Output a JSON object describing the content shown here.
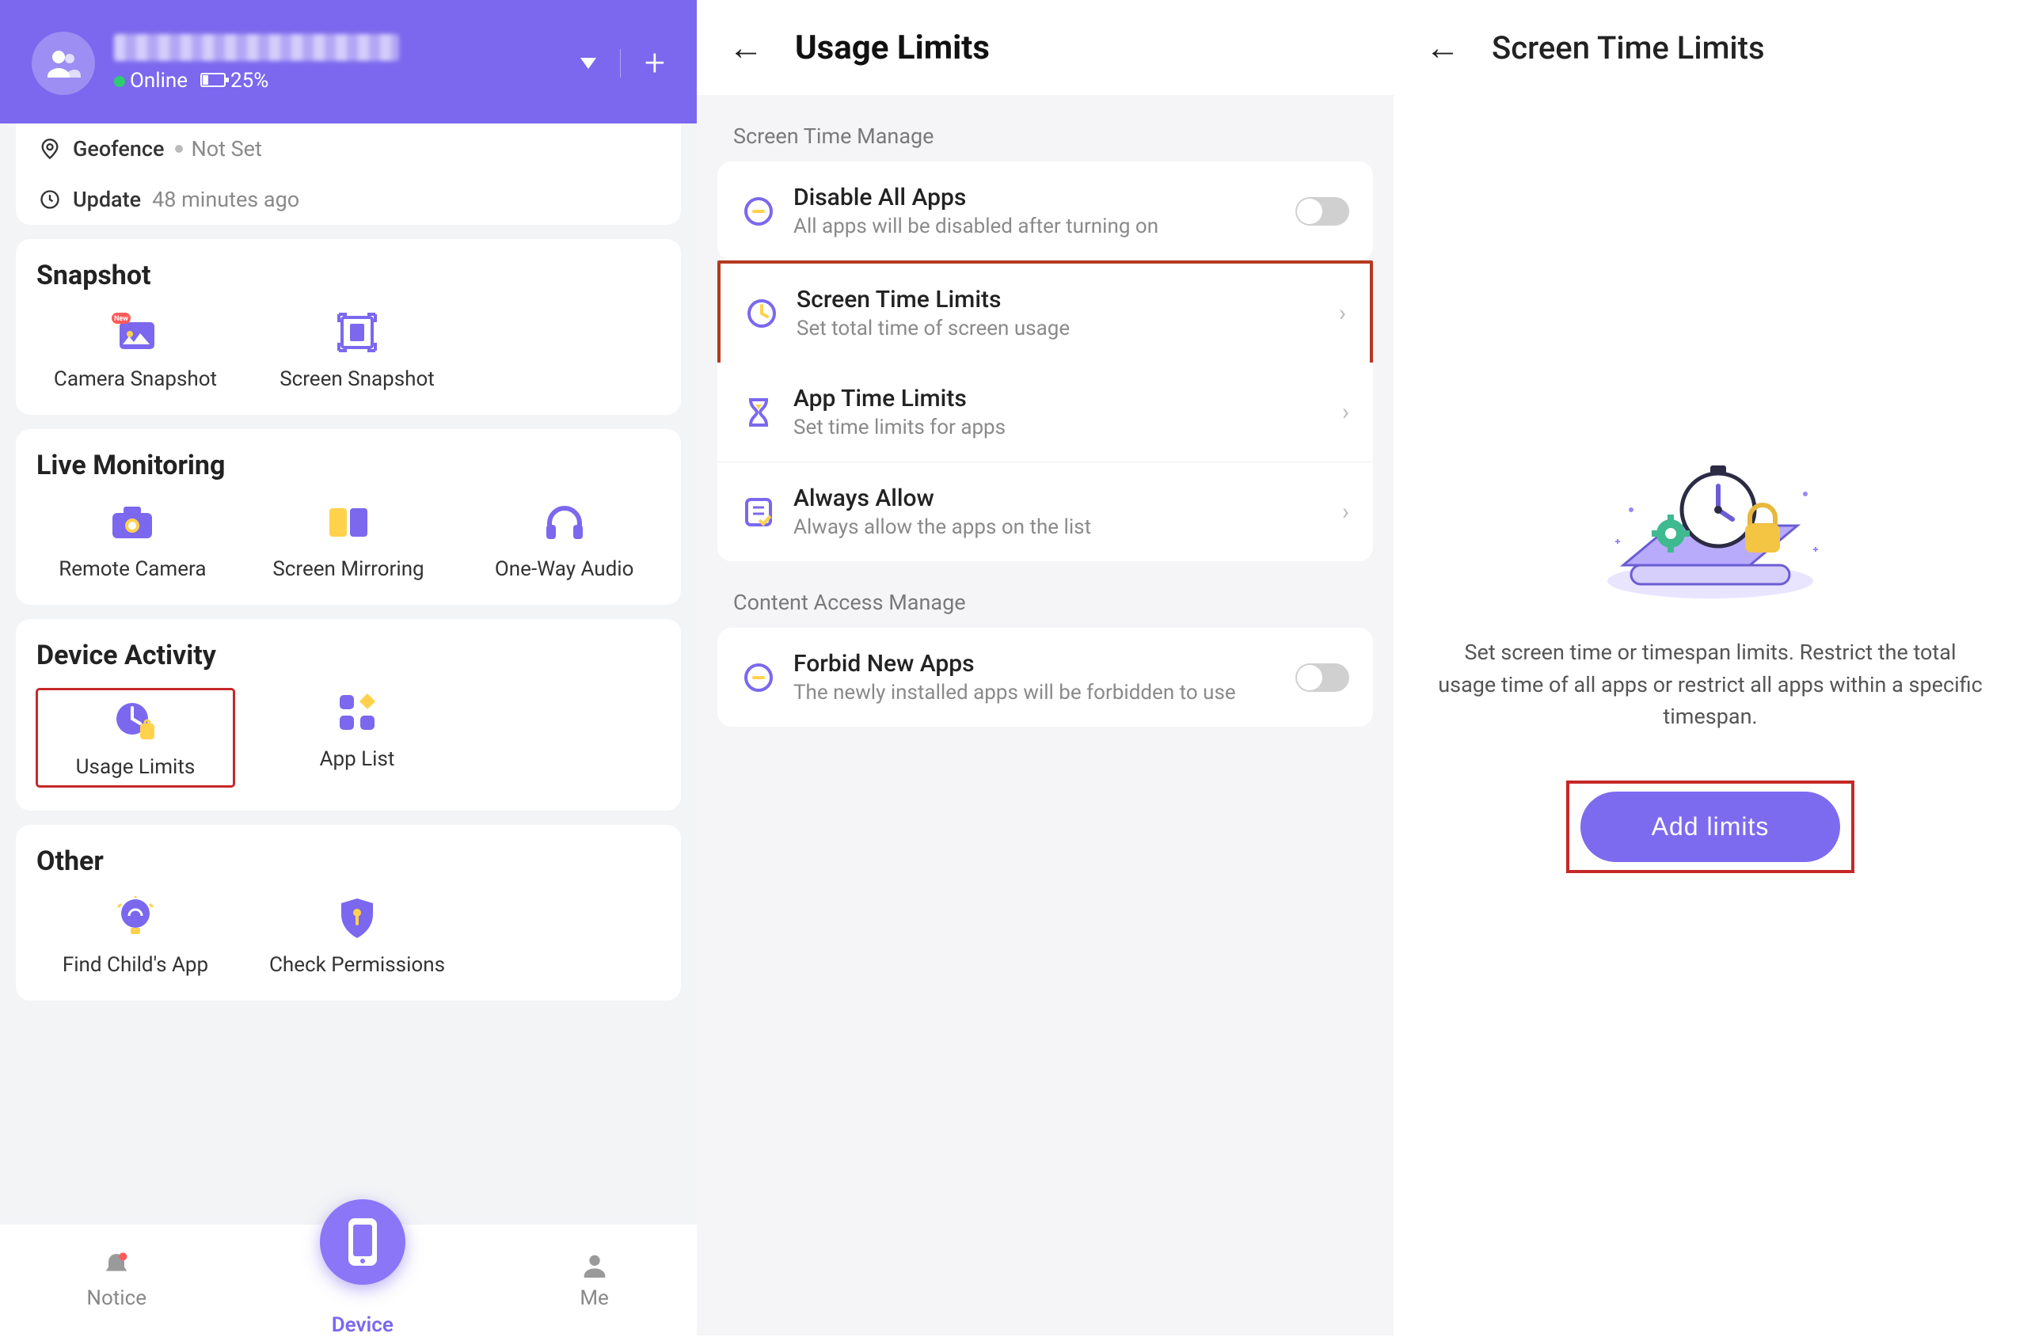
{
  "panel1": {
    "header": {
      "online_label": "Online",
      "battery_label": "25%"
    },
    "meta": {
      "geofence_label": "Geofence",
      "geofence_value": "Not Set",
      "update_label": "Update",
      "update_value": "48 minutes ago"
    },
    "sections": {
      "snapshot": {
        "title": "Snapshot",
        "tiles": [
          "Camera Snapshot",
          "Screen Snapshot"
        ]
      },
      "live": {
        "title": "Live Monitoring",
        "tiles": [
          "Remote Camera",
          "Screen Mirroring",
          "One-Way Audio"
        ]
      },
      "activity": {
        "title": "Device Activity",
        "tiles": [
          "Usage Limits",
          "App List"
        ]
      },
      "other": {
        "title": "Other",
        "tiles": [
          "Find Child's App",
          "Check Permissions"
        ]
      }
    },
    "nav": {
      "notice": "Notice",
      "device": "Device",
      "me": "Me"
    }
  },
  "panel2": {
    "title": "Usage Limits",
    "section1_label": "Screen Time Manage",
    "section2_label": "Content Access Manage",
    "rows": {
      "disable": {
        "title": "Disable All Apps",
        "sub": "All apps will be disabled after turning on"
      },
      "screenTime": {
        "title": "Screen Time Limits",
        "sub": "Set total time of screen usage"
      },
      "appTime": {
        "title": "App Time Limits",
        "sub": "Set time limits for apps"
      },
      "always": {
        "title": "Always Allow",
        "sub": "Always allow the apps on the list"
      },
      "forbid": {
        "title": "Forbid New Apps",
        "sub": "The newly installed apps will be forbidden to use"
      }
    }
  },
  "panel3": {
    "title": "Screen Time Limits",
    "description": "Set screen time or timespan limits. Restrict the total usage time of all apps or restrict all apps within a specific timespan.",
    "button": "Add limits"
  },
  "colors": {
    "primary": "#7b68ee",
    "highlight": "#c62828"
  }
}
